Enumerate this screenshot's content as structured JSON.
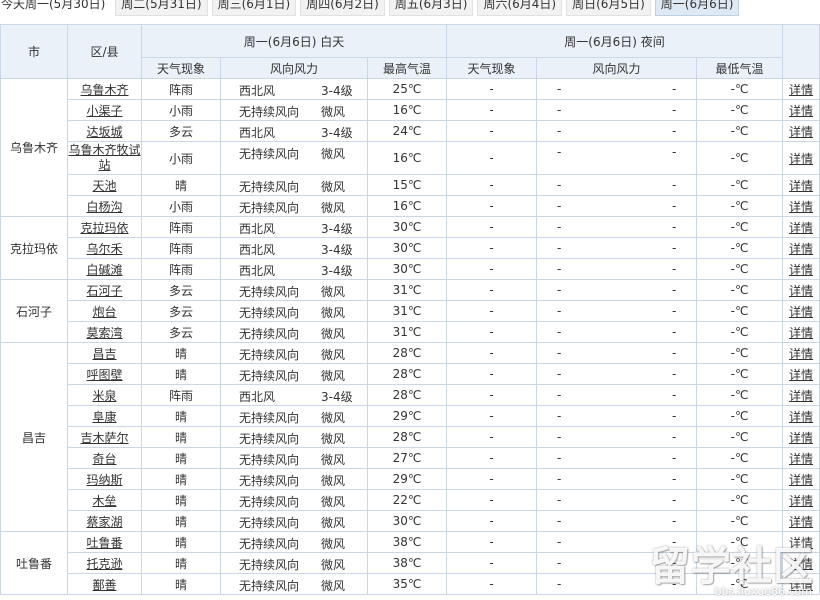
{
  "tabs": [
    {
      "label": "今天周一(5月30日)",
      "active": false
    },
    {
      "label": "周二(5月31日)",
      "active": false
    },
    {
      "label": "周三(6月1日)",
      "active": false
    },
    {
      "label": "周四(6月2日)",
      "active": false
    },
    {
      "label": "周五(6月3日)",
      "active": false
    },
    {
      "label": "周六(6月4日)",
      "active": false
    },
    {
      "label": "周日(6月5日)",
      "active": false
    },
    {
      "label": "周一(6月6日)",
      "active": true
    }
  ],
  "header": {
    "city": "市",
    "county": "区/县",
    "day_group": "周一(6月6日) 白天",
    "night_group": "周一(6月6日) 夜间",
    "day_weather": "天气现象",
    "day_wind": "风向风力",
    "high_temp": "最高气温",
    "night_weather": "天气现象",
    "night_wind": "风向风力",
    "low_temp": "最低气温"
  },
  "detail_label": "详情",
  "night_placeholder": "-",
  "low_temp_placeholder": "-℃",
  "groups": [
    {
      "city": "乌鲁木齐",
      "rows": [
        {
          "county": "乌鲁木齐",
          "weather": "阵雨",
          "wind_dir": "西北风",
          "wind_force": "3-4级",
          "high": "25℃"
        },
        {
          "county": "小渠子",
          "weather": "小雨",
          "wind_dir": "无持续风向",
          "wind_force": "微风",
          "high": "16℃"
        },
        {
          "county": "达坂城",
          "weather": "多云",
          "wind_dir": "西北风",
          "wind_force": "3-4级",
          "high": "24℃"
        },
        {
          "county": "乌鲁木齐牧试站",
          "weather": "小雨",
          "wind_dir": "无持续风向",
          "wind_force": "微风",
          "high": "16℃",
          "tall": true
        },
        {
          "county": "天池",
          "weather": "晴",
          "wind_dir": "无持续风向",
          "wind_force": "微风",
          "high": "15℃"
        },
        {
          "county": "白杨沟",
          "weather": "小雨",
          "wind_dir": "无持续风向",
          "wind_force": "微风",
          "high": "16℃"
        }
      ]
    },
    {
      "city": "克拉玛依",
      "rows": [
        {
          "county": "克拉玛依",
          "weather": "阵雨",
          "wind_dir": "西北风",
          "wind_force": "3-4级",
          "high": "30℃"
        },
        {
          "county": "乌尔禾",
          "weather": "阵雨",
          "wind_dir": "西北风",
          "wind_force": "3-4级",
          "high": "30℃"
        },
        {
          "county": "白碱滩",
          "weather": "阵雨",
          "wind_dir": "西北风",
          "wind_force": "3-4级",
          "high": "30℃"
        }
      ]
    },
    {
      "city": "石河子",
      "rows": [
        {
          "county": "石河子",
          "weather": "多云",
          "wind_dir": "无持续风向",
          "wind_force": "微风",
          "high": "31℃"
        },
        {
          "county": "炮台",
          "weather": "多云",
          "wind_dir": "无持续风向",
          "wind_force": "微风",
          "high": "31℃"
        },
        {
          "county": "莫索湾",
          "weather": "多云",
          "wind_dir": "无持续风向",
          "wind_force": "微风",
          "high": "31℃"
        }
      ]
    },
    {
      "city": "昌吉",
      "rows": [
        {
          "county": "昌吉",
          "weather": "晴",
          "wind_dir": "无持续风向",
          "wind_force": "微风",
          "high": "28℃"
        },
        {
          "county": "呼图壁",
          "weather": "晴",
          "wind_dir": "无持续风向",
          "wind_force": "微风",
          "high": "28℃"
        },
        {
          "county": "米泉",
          "weather": "阵雨",
          "wind_dir": "西北风",
          "wind_force": "3-4级",
          "high": "28℃"
        },
        {
          "county": "阜康",
          "weather": "晴",
          "wind_dir": "无持续风向",
          "wind_force": "微风",
          "high": "29℃"
        },
        {
          "county": "吉木萨尔",
          "weather": "晴",
          "wind_dir": "无持续风向",
          "wind_force": "微风",
          "high": "28℃"
        },
        {
          "county": "奇台",
          "weather": "晴",
          "wind_dir": "无持续风向",
          "wind_force": "微风",
          "high": "27℃"
        },
        {
          "county": "玛纳斯",
          "weather": "晴",
          "wind_dir": "无持续风向",
          "wind_force": "微风",
          "high": "29℃"
        },
        {
          "county": "木垒",
          "weather": "晴",
          "wind_dir": "无持续风向",
          "wind_force": "微风",
          "high": "22℃"
        },
        {
          "county": "蔡家湖",
          "weather": "晴",
          "wind_dir": "无持续风向",
          "wind_force": "微风",
          "high": "30℃"
        }
      ]
    },
    {
      "city": "吐鲁番",
      "rows": [
        {
          "county": "吐鲁番",
          "weather": "晴",
          "wind_dir": "无持续风向",
          "wind_force": "微风",
          "high": "38℃"
        },
        {
          "county": "托克逊",
          "weather": "晴",
          "wind_dir": "无持续风向",
          "wind_force": "微风",
          "high": "38℃"
        },
        {
          "county": "鄯善",
          "weather": "晴",
          "wind_dir": "无持续风向",
          "wind_force": "微风",
          "high": "35℃"
        }
      ]
    }
  ],
  "watermark": {
    "text": "留学社区",
    "url": "bbs.liuxue86.com"
  },
  "colors": {
    "header_bg": "#eaf1f9",
    "border": "#c9d7e6",
    "active_tab": "#dfe9f3"
  }
}
